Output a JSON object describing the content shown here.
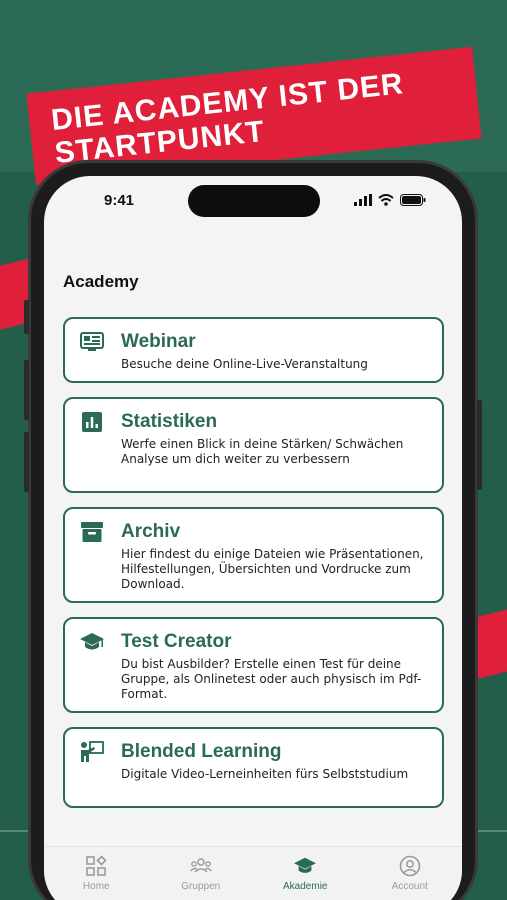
{
  "banner": {
    "line1": "DIE ACADEMY IST DER",
    "line2": "STARTPUNKT"
  },
  "status_bar": {
    "time": "9:41"
  },
  "page_title": "Academy",
  "cards": [
    {
      "icon": "webinar-icon",
      "title": "Webinar",
      "description": "Besuche deine Online-Live-Veranstaltung"
    },
    {
      "icon": "bar-chart-icon",
      "title": "Statistiken",
      "description": "Werfe einen Blick in deine Stärken/ Schwächen Analyse um dich weiter zu verbessern"
    },
    {
      "icon": "archive-box-icon",
      "title": "Archiv",
      "description": "Hier findest du einige Dateien wie Präsentationen, Hilfestellungen, Übersichten und Vordrucke zum Download."
    },
    {
      "icon": "graduation-cap-icon",
      "title": "Test Creator",
      "description": "Du bist Ausbilder? Erstelle einen Test für deine Gruppe, als Onlinetest oder auch physisch im Pdf-Format."
    },
    {
      "icon": "presenter-icon",
      "title": "Blended Learning",
      "description": "Digitale Video-Lerneinheiten fürs Selbststudium"
    }
  ],
  "tabs": [
    {
      "label": "Home",
      "icon": "home-grid-icon",
      "active": false
    },
    {
      "label": "Gruppen",
      "icon": "groups-icon",
      "active": false
    },
    {
      "label": "Akademie",
      "icon": "graduation-cap-icon",
      "active": true
    },
    {
      "label": "Account",
      "icon": "account-icon",
      "active": false
    }
  ],
  "colors": {
    "brand_green": "#2b6a55",
    "accent_red": "#e0203a",
    "background": "#235e4b"
  }
}
